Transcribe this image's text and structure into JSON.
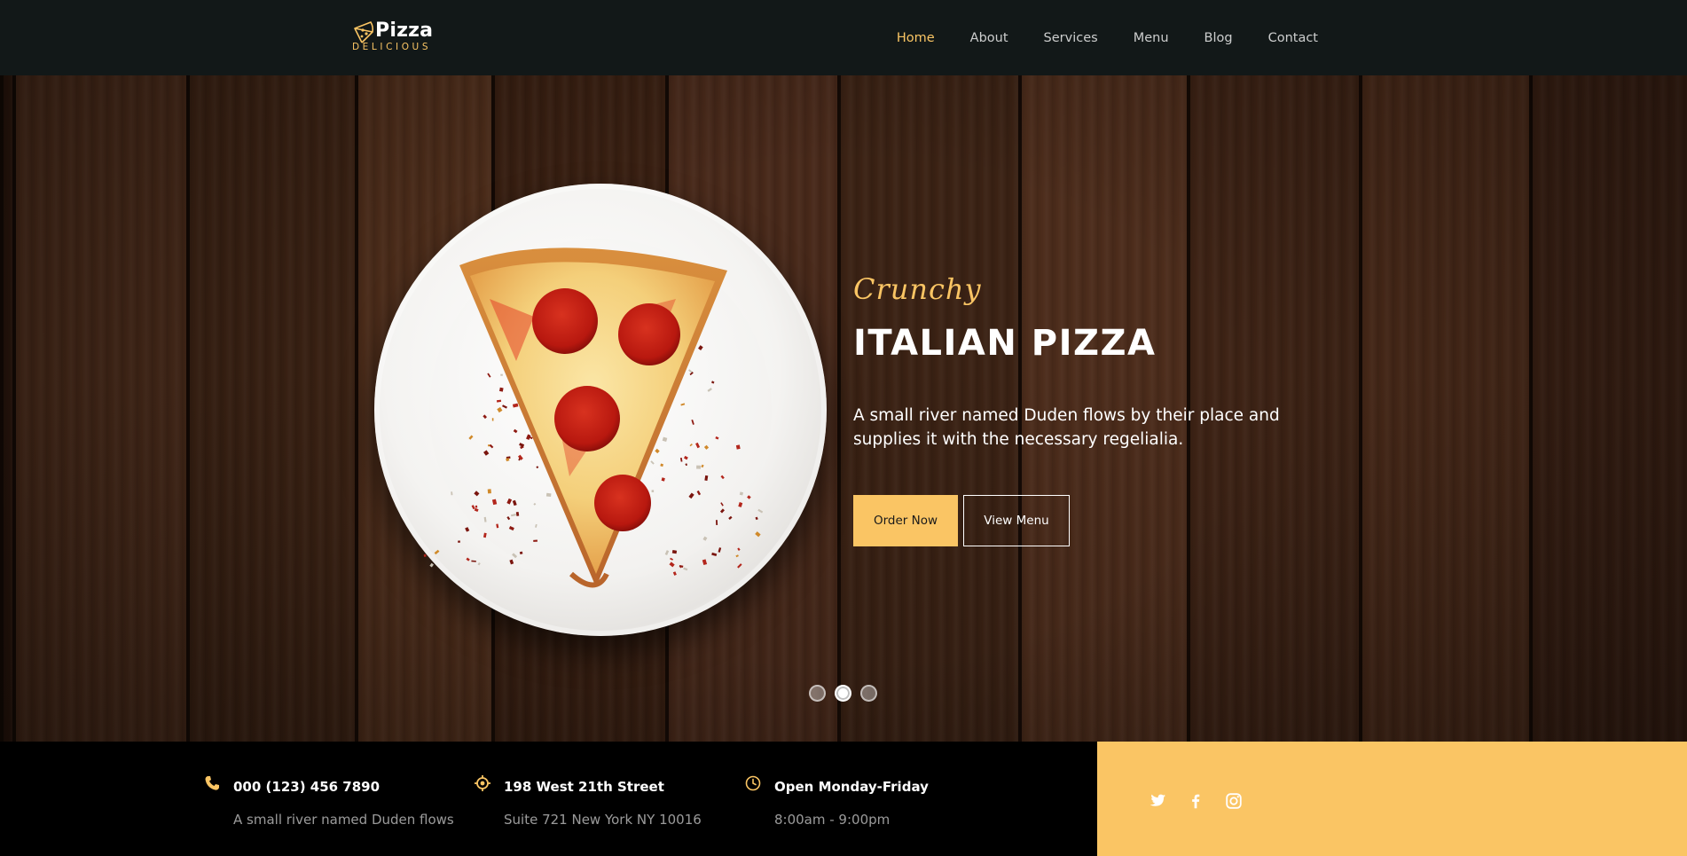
{
  "brand": {
    "main": "Pizza",
    "sub": "DELICIOUS"
  },
  "nav": {
    "items": [
      {
        "label": "Home",
        "active": true
      },
      {
        "label": "About",
        "active": false
      },
      {
        "label": "Services",
        "active": false
      },
      {
        "label": "Menu",
        "active": false
      },
      {
        "label": "Blog",
        "active": false
      },
      {
        "label": "Contact",
        "active": false
      }
    ]
  },
  "hero": {
    "subheading": "Crunchy",
    "title": "ITALIAN PIZZA",
    "text": "A small river named Duden flows by their place and supplies it with the necessary regelialia.",
    "order_button": "Order Now",
    "menu_button": "View Menu",
    "slides": 3,
    "active_slide": 2
  },
  "info": {
    "phone": {
      "icon": "phone-icon",
      "title": "000 (123) 456 7890",
      "desc": "A small river named Duden flows"
    },
    "address": {
      "icon": "location-icon",
      "title": "198 West 21th Street",
      "desc": "Suite 721 New York NY 10016"
    },
    "hours": {
      "icon": "clock-icon",
      "title": "Open Monday-Friday",
      "desc": "8:00am - 9:00pm"
    }
  },
  "social": [
    "twitter-icon",
    "facebook-icon",
    "instagram-icon"
  ],
  "colors": {
    "accent": "#fac564",
    "nav_bg": "#121818",
    "info_bg": "#000000",
    "wood": "#3b2114"
  }
}
